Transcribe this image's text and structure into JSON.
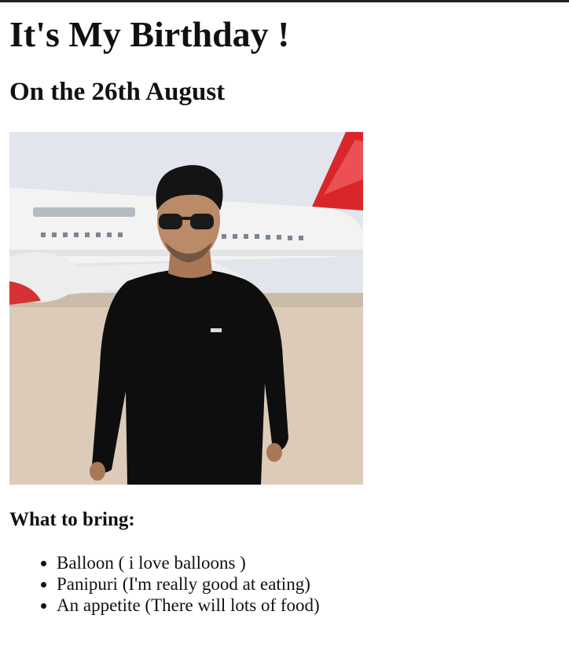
{
  "page": {
    "title": "It's My Birthday !",
    "date": "On the 26th August",
    "bring_heading": "What to bring:",
    "bring_items": [
      "Balloon ( i love balloons )",
      "Panipuri (I'm really good at eating)",
      "An appetite (There will lots of food)"
    ]
  },
  "photo": {
    "subject": "young man in sunglasses and black sweater standing in front of a parked airplane",
    "colors": {
      "sky": "#dfe3ea",
      "tarmac": "#d9c9b8",
      "fuselage": "#f4f4f4",
      "tail_red": "#d7262b",
      "sweater": "#0d0d0d",
      "skin": "#b98866",
      "hair": "#131313"
    }
  }
}
